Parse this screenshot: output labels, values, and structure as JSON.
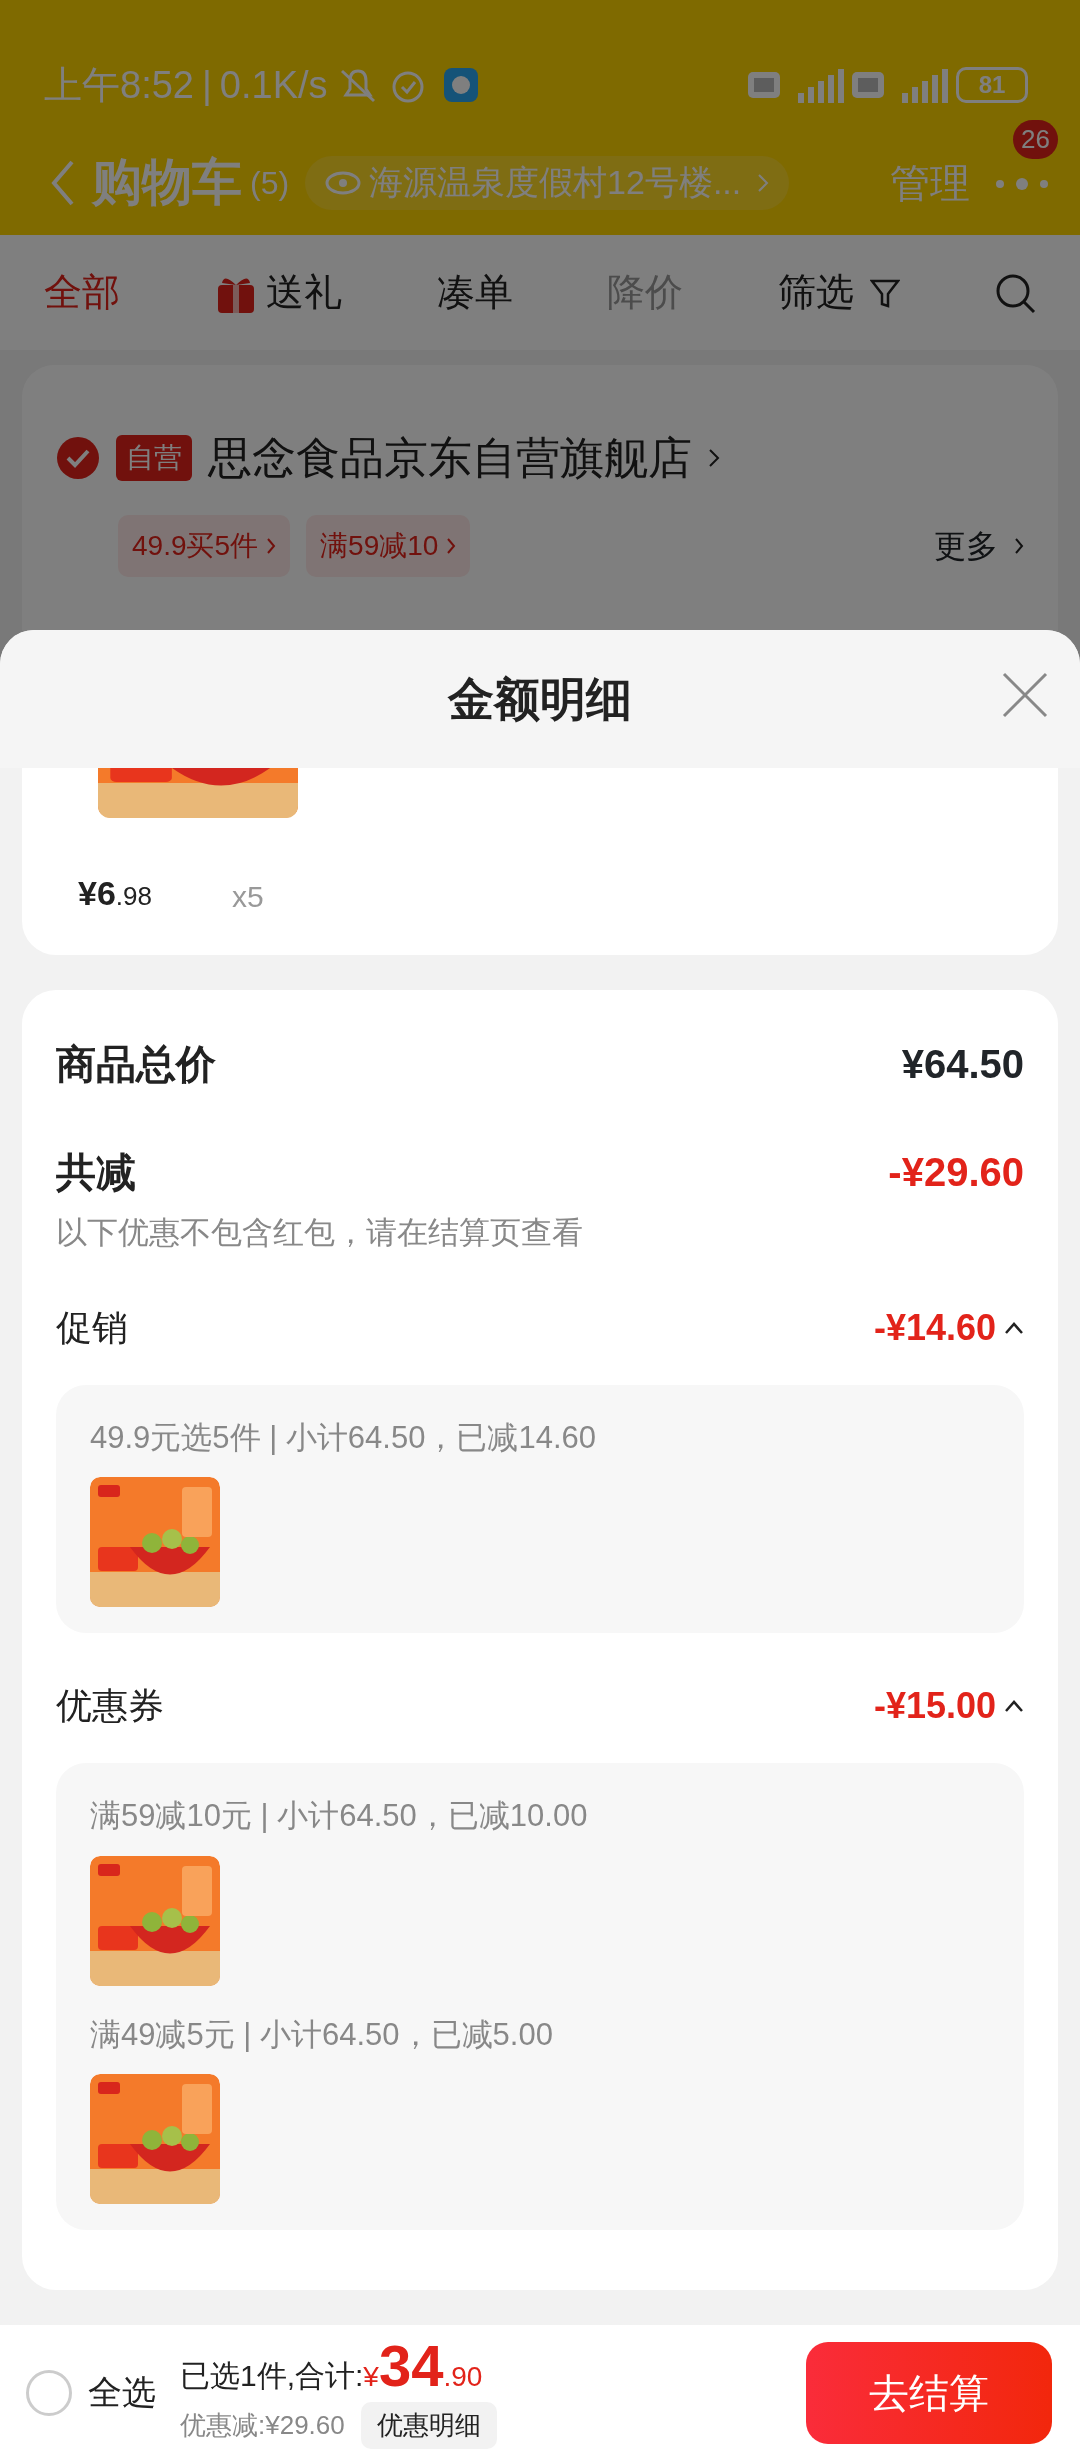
{
  "status_bar": {
    "time": "上午8:52",
    "separator": "|",
    "speed": "0.1K/s",
    "battery": "81"
  },
  "header": {
    "title": "购物车",
    "count": "(5)",
    "address": "海源温泉度假村12号楼...",
    "manage": "管理",
    "badge": "26"
  },
  "tabs": [
    {
      "label": "全部",
      "kind": "plain",
      "selected": true,
      "disabled": false
    },
    {
      "label": "送礼",
      "kind": "gift",
      "selected": false,
      "disabled": false
    },
    {
      "label": "凑单",
      "kind": "plain",
      "selected": false,
      "disabled": false
    },
    {
      "label": "降价",
      "kind": "plain",
      "selected": false,
      "disabled": true
    },
    {
      "label": "筛选",
      "kind": "filter",
      "selected": false,
      "disabled": false
    }
  ],
  "store": {
    "checked": true,
    "tag": "自营",
    "name": "思念食品京东自营旗舰店",
    "promos": [
      "49.9买5件",
      "满59减10"
    ],
    "more": "更多"
  },
  "sheet": {
    "title": "金额明细",
    "item": {
      "currency": "¥",
      "price_int": "6",
      "price_dec": ".98",
      "qty": "x5"
    },
    "summary": {
      "total_label": "商品总价",
      "total": "¥64.50",
      "reduce_label": "共减",
      "reduce": "-¥29.60",
      "note": "以下优惠不包含红包，请在结算页查看"
    },
    "sections": [
      {
        "label": "促销",
        "amount": "-¥14.60",
        "expanded": true,
        "groups": [
          {
            "text": "49.9元选5件 | 小计64.50，已减14.60"
          }
        ]
      },
      {
        "label": "优惠券",
        "amount": "-¥15.00",
        "expanded": true,
        "groups": [
          {
            "text": "满59减10元 | 小计64.50，已减10.00"
          },
          {
            "text": "满49减5元 | 小计64.50，已减5.00"
          }
        ]
      }
    ]
  },
  "bottom_bar": {
    "select_all": {
      "label": "全选",
      "checked": false
    },
    "selected_text": "已选1件,合计:",
    "currency": "¥",
    "total_int": "34",
    "total_dec": ".90",
    "saved": "优惠减:¥29.60",
    "detail_button": "优惠明细",
    "checkout": "去结算"
  }
}
